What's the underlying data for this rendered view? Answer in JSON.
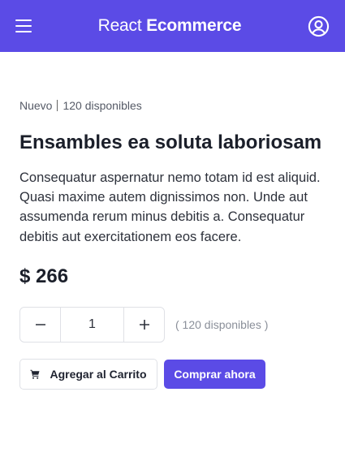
{
  "header": {
    "brand_light": "React",
    "brand_bold": "Ecommerce",
    "menu_icon": "hamburger-menu-icon",
    "user_icon": "user-circle-icon",
    "bg_color": "#5b4be6"
  },
  "product": {
    "condition": "Nuevo",
    "stock_text": "120 disponibles",
    "title": "Ensambles ea soluta laboriosam",
    "description": "Consequatur aspernatur nemo totam id est aliquid. Quasi maxime autem dignissimos non. Unde aut assumenda rerum minus debitis a. Consequatur debitis aut exercitationem eos facere.",
    "price": "$ 266"
  },
  "quantity": {
    "value": "1",
    "available_text": "( 120 disponibles )",
    "decrement_icon": "minus-icon",
    "increment_icon": "plus-icon"
  },
  "actions": {
    "add_to_cart_label": "Agregar al Carrito",
    "cart_icon": "cart-icon",
    "buy_now_label": "Comprar ahora",
    "accent_color": "#5b4be6"
  }
}
